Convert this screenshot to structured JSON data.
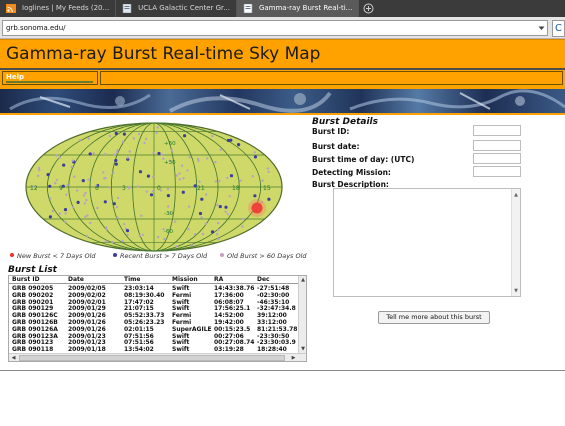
{
  "browser": {
    "tabs": [
      {
        "label": "Ioglines | My Feeds (20...",
        "active": false,
        "icon": "feed-icon"
      },
      {
        "label": "UCLA Galactic Center Gr...",
        "active": false,
        "icon": "page-icon"
      },
      {
        "label": "Gamma-ray Burst Real-ti...",
        "active": true,
        "icon": "page-icon"
      }
    ],
    "new_tab_icon": "plus-circle-icon",
    "url": "grb.sonoma.edu/",
    "go_glyph": "C"
  },
  "page": {
    "title": "Gamma-ray Burst Real-time Sky Map",
    "menu": {
      "help": "Help"
    },
    "colors": {
      "accent": "#ffa200",
      "new_burst": "#e8322b",
      "recent_burst": "#3d3d9c",
      "old_burst": "#c7a0c6"
    }
  },
  "skymap": {
    "lat_labels": [
      "+60",
      "+30",
      "-30",
      "-60"
    ],
    "lon_labels": [
      "12",
      "9",
      "6",
      "3",
      "0",
      "21",
      "18",
      "15"
    ],
    "legend": {
      "new": "New Burst < 7 Days Old",
      "recent": "Recent Burst > 7 Days Old",
      "old": "Old Burst > 60 Days Old"
    }
  },
  "burst_list": {
    "title": "Burst List",
    "columns": [
      "Burst ID",
      "Date",
      "Time",
      "Mission",
      "RA",
      "Dec"
    ],
    "rows": [
      [
        "GRB 090205",
        "2009/02/05",
        "23:03:14",
        "Swift",
        "14:43:38.76",
        "-27:51:48"
      ],
      [
        "GRB 090202",
        "2009/02/02",
        "08:19:30.40",
        "Fermi",
        "17:36:00",
        "-02:30:00"
      ],
      [
        "GRB 090201",
        "2009/02/01",
        "17:47:02",
        "Swift",
        "06:08:07",
        "-46:35:10"
      ],
      [
        "GRB 090129",
        "2009/01/29",
        "21:07:15",
        "Swift",
        "17:56:25.1",
        "-32:47:34.8"
      ],
      [
        "GRB 090126C",
        "2009/01/26",
        "05:52:33.73",
        "Fermi",
        "14:52:00",
        "39:12:00"
      ],
      [
        "GRB 090126B",
        "2009/01/26",
        "05:26:23.23",
        "Fermi",
        "19:42:00",
        "33:12:00"
      ],
      [
        "GRB 090126A",
        "2009/01/26",
        "02:01:15",
        "SuperAGILE",
        "00:15:23.5",
        "81:21:53.78"
      ],
      [
        "GRB 090123A",
        "2009/01/23",
        "07:51:56",
        "Swift",
        "00:27:06",
        "-23:30:50"
      ],
      [
        "GRB 090123",
        "2009/01/23",
        "07:51:56",
        "Swift",
        "00:27:08.74",
        "-23:30:03.9"
      ],
      [
        "GRB 090118",
        "2009/01/18",
        "13:54:02",
        "Swift",
        "03:19:28",
        "18:28:40"
      ]
    ]
  },
  "details": {
    "title": "Burst Details",
    "fields": [
      {
        "label": "Burst ID:",
        "value": ""
      },
      {
        "label": "Burst date:",
        "value": ""
      },
      {
        "label": "Burst time of day: (UTC)",
        "value": ""
      },
      {
        "label": "Detecting Mission:",
        "value": ""
      }
    ],
    "description_label": "Burst Description:",
    "description_value": "",
    "button": "Tell me more about this burst"
  }
}
